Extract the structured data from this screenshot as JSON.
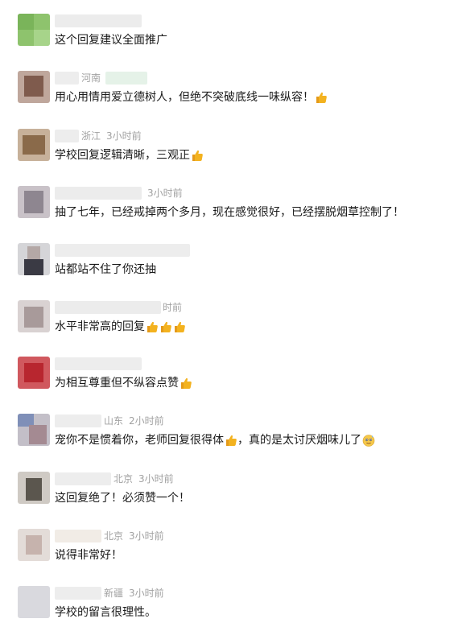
{
  "comments": [
    {
      "location": "",
      "time": "",
      "text": "这个回复建议全面推广",
      "emojis": []
    },
    {
      "location": "河南",
      "time": "",
      "text": "用心用情用爱立德树人，但绝不突破底线一味纵容！",
      "emojis": [
        "thumbs-up"
      ]
    },
    {
      "location": "浙江",
      "time": "3小时前",
      "text": "学校回复逻辑清晰，三观正",
      "emojis": [
        "thumbs-up"
      ]
    },
    {
      "location": "",
      "time": "3小时前",
      "text": "抽了七年，已经戒掉两个多月，现在感觉很好，已经摆脱烟草控制了！",
      "emojis": []
    },
    {
      "location": "",
      "time": "",
      "text": "站都站不住了你还抽",
      "emojis": []
    },
    {
      "location": "",
      "time": "时前",
      "text": "水平非常高的回复",
      "emojis": [
        "thumbs-up",
        "thumbs-up",
        "thumbs-up"
      ]
    },
    {
      "location": "",
      "time": "",
      "text": "为相互尊重但不纵容点赞",
      "emojis": [
        "thumbs-up"
      ]
    },
    {
      "location": "山东",
      "time": "2小时前",
      "text": "宠你不是惯着你，老师回复很得体",
      "text2": "，真的是太讨厌烟味儿了",
      "emojis": [
        "thumbs-up"
      ],
      "emojis2": [
        "sweat-smile"
      ]
    },
    {
      "location": "北京",
      "time": "3小时前",
      "text": "这回复绝了！必须赞一个！",
      "emojis": []
    },
    {
      "location": "北京",
      "time": "3小时前",
      "text": "说得非常好！",
      "emojis": []
    },
    {
      "location": "新疆",
      "time": "3小时前",
      "text": "学校的留言很理性。",
      "emojis": []
    }
  ],
  "colors": {
    "text": "#1a1a1a",
    "meta": "#a1a1a1",
    "thumb": "#f3b21f"
  }
}
